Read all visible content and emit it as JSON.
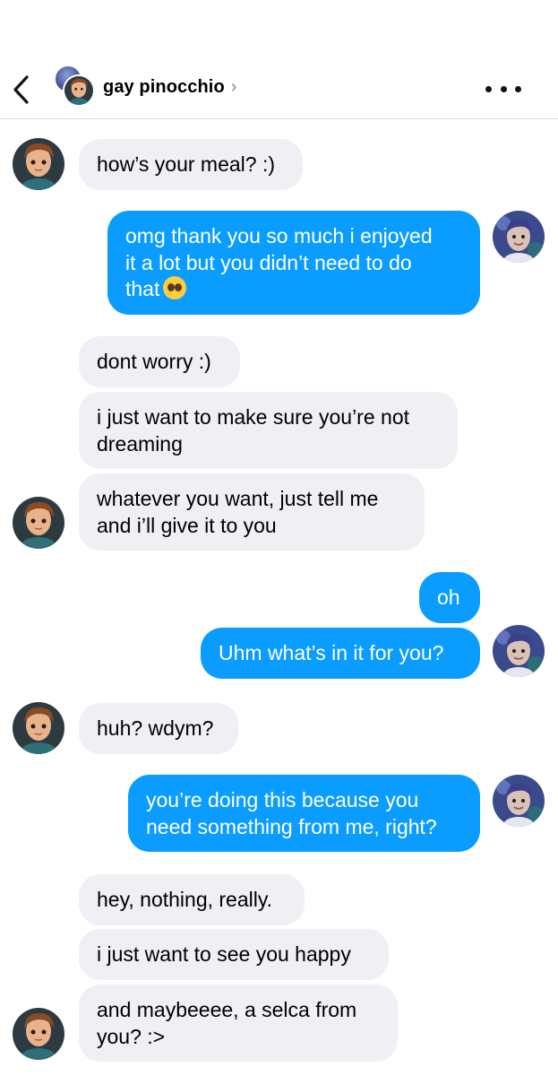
{
  "header": {
    "contact_name": "gay pinocchio",
    "title_chevron": "›",
    "back_icon": "chevron-left-icon",
    "more_icon": "more-horizontal-icon"
  },
  "colors": {
    "outgoing_bubble": "#0a9dff",
    "incoming_bubble": "#efeff4",
    "outgoing_text": "#ffffff",
    "incoming_text": "#000000"
  },
  "messages": [
    {
      "from": "them",
      "lines": [
        "how’s your meal? :)"
      ]
    },
    {
      "from": "me",
      "lines": [
        "omg thank you so much i enjoyed",
        "it a lot but you didn’t need to do",
        "that"
      ],
      "emoji": "pleading-face-emoji"
    },
    {
      "from": "them",
      "lines": [
        "dont worry :)"
      ]
    },
    {
      "from": "them",
      "lines": [
        "i just want to make sure you’re not",
        "dreaming"
      ]
    },
    {
      "from": "them",
      "lines": [
        "whatever you want, just tell me",
        "and i’ll give it to you"
      ]
    },
    {
      "from": "me",
      "lines": [
        "oh"
      ]
    },
    {
      "from": "me",
      "lines": [
        "Uhm what’s in it for you?"
      ]
    },
    {
      "from": "them",
      "lines": [
        "huh? wdym?"
      ]
    },
    {
      "from": "me",
      "lines": [
        "you’re doing this because you",
        "need something from me, right?"
      ]
    },
    {
      "from": "them",
      "lines": [
        "hey, nothing, really."
      ]
    },
    {
      "from": "them",
      "lines": [
        "i just want to see you happy"
      ]
    },
    {
      "from": "them",
      "lines": [
        "and maybeeee, a selca from",
        "you? :>"
      ]
    }
  ]
}
